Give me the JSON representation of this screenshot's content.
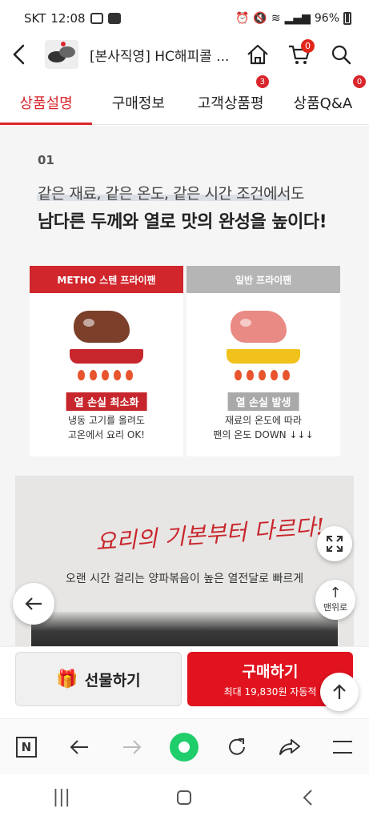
{
  "status": {
    "carrier": "SKT",
    "time": "12:08",
    "battery": "96%"
  },
  "header": {
    "back_icon": "back-arrow-icon",
    "title": "[본사직영] HC해피콜 ...",
    "cart_badge": "0"
  },
  "tabs": [
    {
      "label": "상품설명",
      "badge": ""
    },
    {
      "label": "구매정보",
      "badge": ""
    },
    {
      "label": "고객상품평",
      "badge": "3"
    },
    {
      "label": "상품Q&A",
      "badge": "0"
    }
  ],
  "content": {
    "section_number": "01",
    "headline_line1": "같은 재료, 같은 온도, 같은 시간 조건에서도",
    "headline_line2": "남다른 두께와 열로 맛의 완성을 높이다!",
    "cards": [
      {
        "header": "METHO 스텐 프라이팬",
        "tag": "열 손실 최소화",
        "desc_line1": "냉동 고기를 올려도",
        "desc_line2": "고온에서 요리 OK!"
      },
      {
        "header": "일반 프라이팬",
        "tag": "열 손실 발생",
        "desc_line1": "재료의 온도에 따라",
        "desc_line2": "팬의 온도 DOWN ↓↓↓"
      }
    ],
    "banner_script": "요리의 기본부터 다르다!",
    "banner_sub": "오랜 시간 걸리는 양파볶음이 높은 열전달로 빠르게"
  },
  "floating": {
    "scroll_top_label": "맨위로"
  },
  "actions": {
    "gift_label": "선물하기",
    "buy_label": "구매하기",
    "buy_sub": "최대 19,830원 자동적"
  },
  "browser": {
    "n_label": "N"
  },
  "colors": {
    "accent": "#d9262c",
    "buy": "#e1131f",
    "green": "#1fcd6b"
  }
}
